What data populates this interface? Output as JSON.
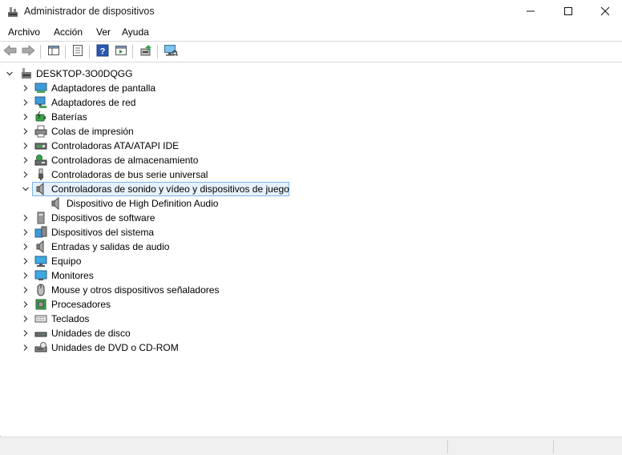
{
  "window": {
    "title": "Administrador de dispositivos",
    "controls": [
      "minimize-icon",
      "maximize-icon",
      "close-icon"
    ]
  },
  "menu": {
    "items": [
      "Archivo",
      "Acción",
      "Ver",
      "Ayuda"
    ]
  },
  "toolbar": {
    "buttons": [
      "back-arrow-icon",
      "forward-arrow-icon",
      "show-hide-console-tree-icon",
      "properties-icon",
      "help-icon",
      "view-icon",
      "update-driver-icon",
      "scan-hardware-icon"
    ]
  },
  "tree": {
    "root": "DESKTOP-3O0DQGG",
    "categories": [
      {
        "label": "Adaptadores de pantalla",
        "icon": "display-adapter-icon"
      },
      {
        "label": "Adaptadores de red",
        "icon": "network-adapter-icon"
      },
      {
        "label": "Baterías",
        "icon": "battery-icon"
      },
      {
        "label": "Colas de impresión",
        "icon": "printer-icon"
      },
      {
        "label": "Controladoras ATA/ATAPI IDE",
        "icon": "ide-controller-icon"
      },
      {
        "label": "Controladoras de almacenamiento",
        "icon": "storage-controller-icon"
      },
      {
        "label": "Controladoras de bus serie universal",
        "icon": "usb-icon"
      },
      {
        "label": "Controladoras de sonido y vídeo y dispositivos de juego",
        "icon": "speaker-icon",
        "expanded": true
      },
      {
        "label": "Dispositivo de High Definition Audio",
        "icon": "speaker-icon",
        "child": true
      },
      {
        "label": "Dispositivos de software",
        "icon": "software-device-icon"
      },
      {
        "label": "Dispositivos del sistema",
        "icon": "system-device-icon"
      },
      {
        "label": "Entradas y salidas de audio",
        "icon": "audio-io-icon"
      },
      {
        "label": "Equipo",
        "icon": "computer-icon"
      },
      {
        "label": "Monitores",
        "icon": "monitor-icon"
      },
      {
        "label": "Mouse y otros dispositivos señaladores",
        "icon": "mouse-icon"
      },
      {
        "label": "Procesadores",
        "icon": "processor-icon"
      },
      {
        "label": "Teclados",
        "icon": "keyboard-icon"
      },
      {
        "label": "Unidades de disco",
        "icon": "disk-drive-icon"
      },
      {
        "label": "Unidades de DVD o CD-ROM",
        "icon": "dvd-drive-icon"
      }
    ]
  },
  "colors": {
    "selection_fill": "#e5f1fb",
    "selection_border": "#7eb4ea"
  }
}
